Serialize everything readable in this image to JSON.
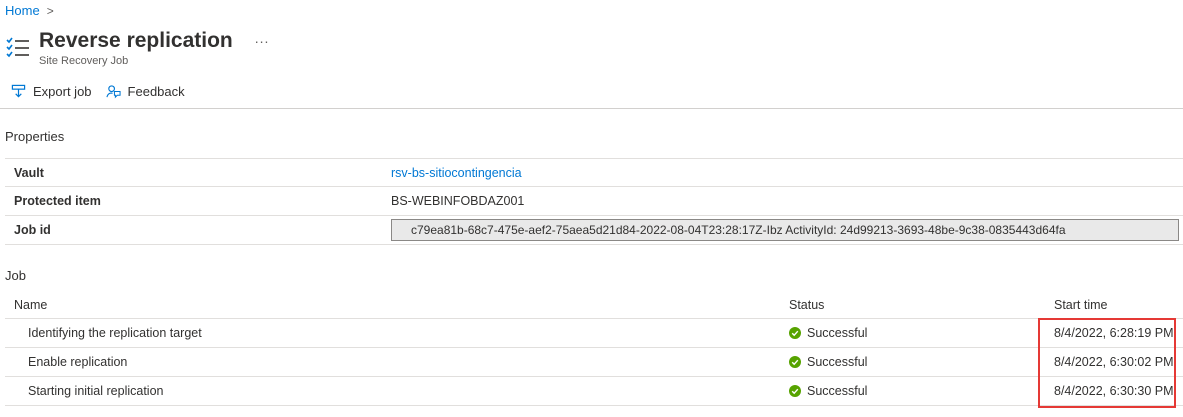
{
  "breadcrumb": {
    "home": "Home",
    "separator": ">"
  },
  "header": {
    "title": "Reverse replication",
    "more": "...",
    "subtitle": "Site Recovery Job",
    "icon": "job-list-icon"
  },
  "toolbar": {
    "export_label": "Export job",
    "export_icon": "export-icon",
    "feedback_label": "Feedback",
    "feedback_icon": "feedback-icon"
  },
  "properties": {
    "section_title": "Properties",
    "rows": [
      {
        "key": "Vault",
        "value": "rsv-bs-sitiocontingencia"
      },
      {
        "key": "Protected item",
        "value": "BS-WEBINFOBDAZ001"
      },
      {
        "key": "Job id",
        "value": "c79ea81b-68c7-475e-aef2-75aea5d21d84-2022-08-04T23:28:17Z-Ibz ActivityId: 24d99213-3693-48be-9c38-0835443d64fa"
      }
    ]
  },
  "job": {
    "section_title": "Job",
    "columns": {
      "name": "Name",
      "status": "Status",
      "start": "Start time"
    },
    "rows": [
      {
        "name": "Identifying the replication target",
        "status": "Successful",
        "start": "8/4/2022, 6:28:19 PM"
      },
      {
        "name": "Enable replication",
        "status": "Successful",
        "start": "8/4/2022, 6:30:02 PM"
      },
      {
        "name": "Starting initial replication",
        "status": "Successful",
        "start": "8/4/2022, 6:30:30 PM"
      }
    ]
  },
  "colors": {
    "accent": "#0078d4",
    "success": "#57a300",
    "highlight": "#e53935"
  }
}
